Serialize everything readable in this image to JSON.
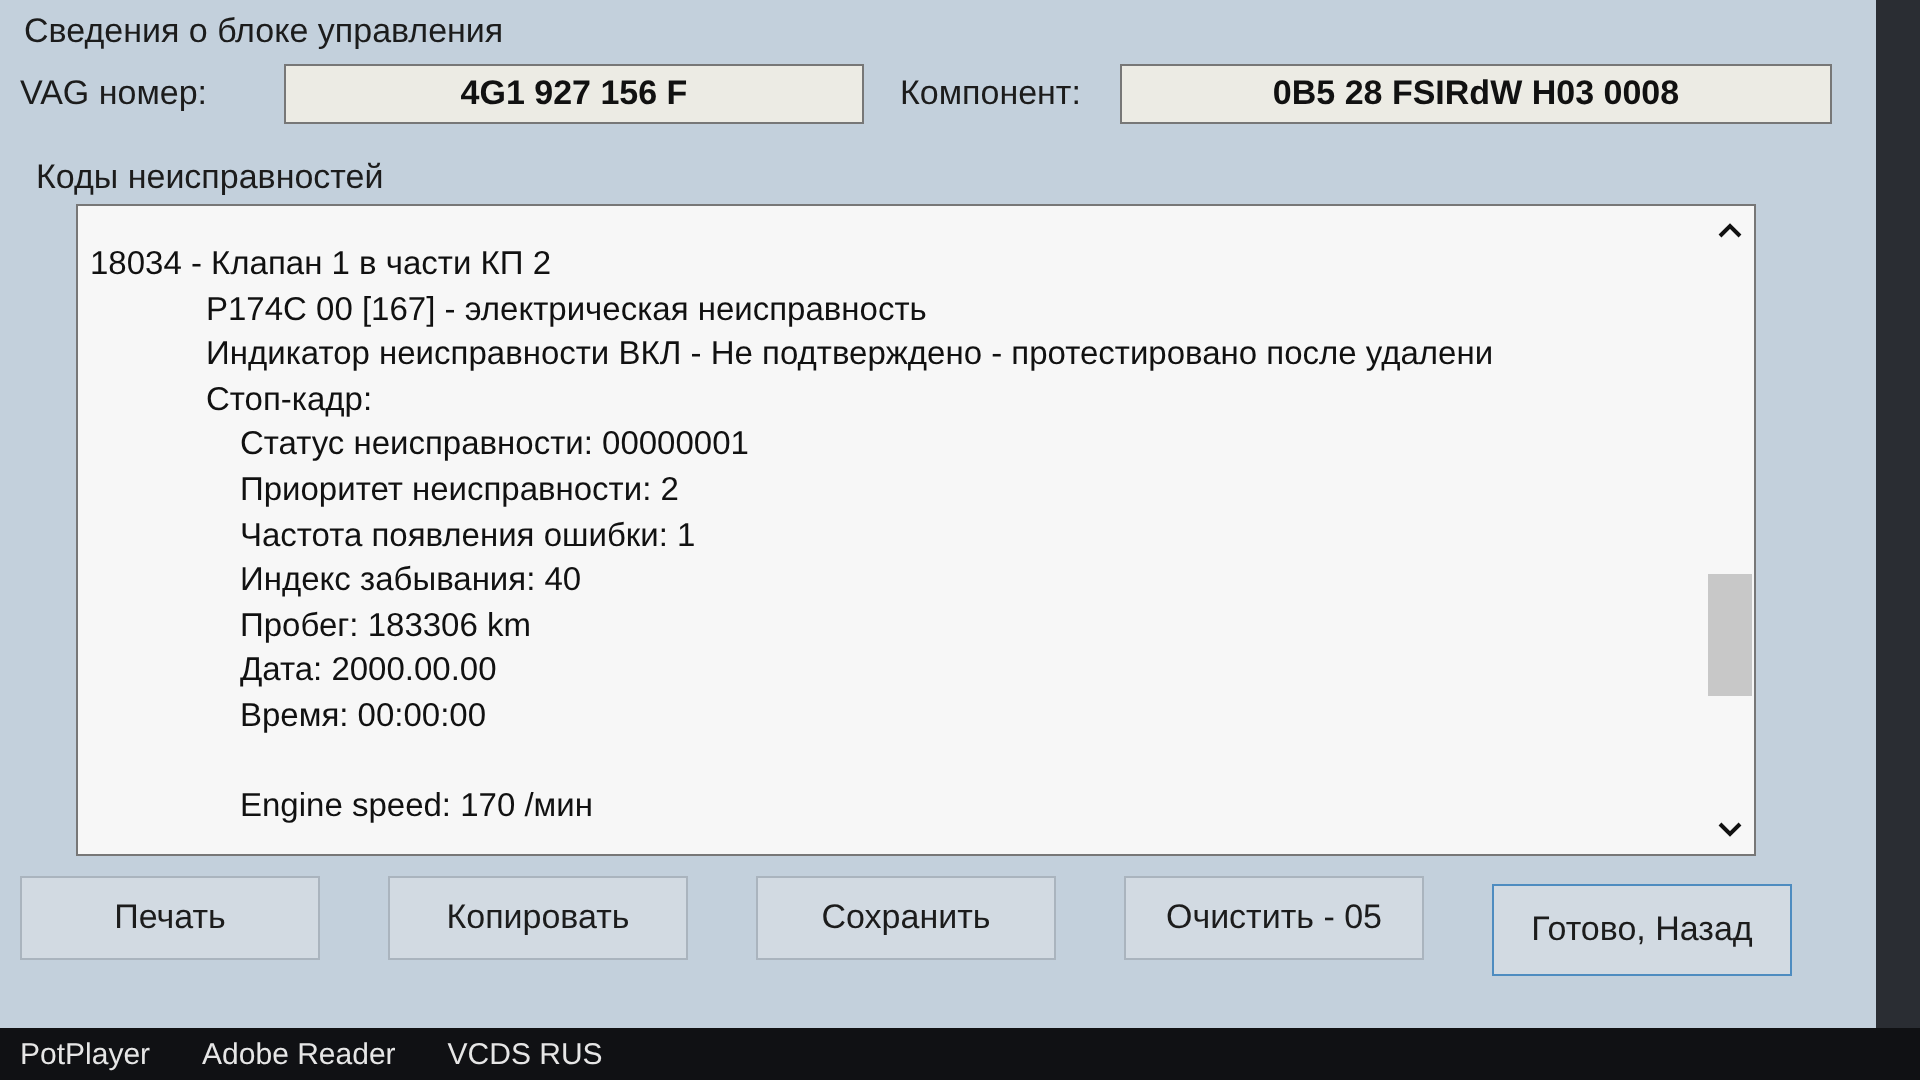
{
  "control_unit": {
    "title": "Сведения о блоке управления",
    "vag_label": "VAG номер:",
    "vag_value": "4G1 927 156 F",
    "component_label": "Компонент:",
    "component_value": "0B5 28 FSIRdW H03 0008"
  },
  "faults": {
    "title": "Коды неисправностей",
    "lines": [
      {
        "text": "18034 - Клапан 1 в части КП 2",
        "children": [
          {
            "text": "P174C 00 [167] - электрическая неисправность"
          },
          {
            "text": "Индикатор неисправности ВКЛ - Не подтверждено - протестировано после удалени"
          },
          {
            "text": "Стоп-кадр:",
            "children": [
              {
                "text": "Статус неисправности: 00000001"
              },
              {
                "text": "Приоритет неисправности: 2"
              },
              {
                "text": "Частота появления ошибки: 1"
              },
              {
                "text": "Индекс забывания: 40"
              },
              {
                "text": "Пробег: 183306 km"
              },
              {
                "text": "Дата: 2000.00.00"
              },
              {
                "text": "Время: 00:00:00"
              },
              {
                "text": "Engine speed: 170 /мин",
                "spaced": true
              }
            ]
          }
        ]
      }
    ]
  },
  "buttons": [
    {
      "label": "Печать",
      "selected": false
    },
    {
      "label": "Копировать",
      "selected": false
    },
    {
      "label": "Сохранить",
      "selected": false
    },
    {
      "label": "Очистить - 05",
      "selected": false
    },
    {
      "label": "Готово, Назад",
      "selected": true
    }
  ],
  "taskbar": [
    "PotPlayer",
    "Adobe Reader",
    "VCDS RUS"
  ]
}
